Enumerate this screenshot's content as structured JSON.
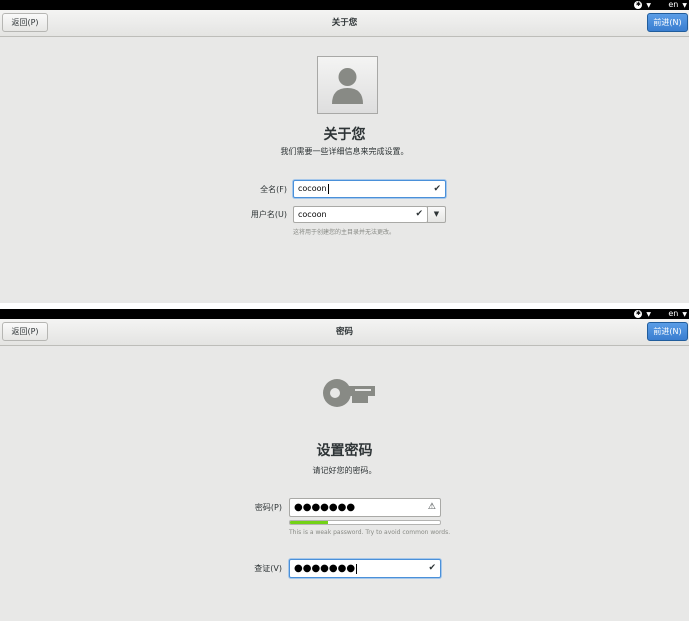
{
  "screen1": {
    "topbar": {
      "accessibility_icon": "accessibility-icon",
      "lang": "en"
    },
    "header": {
      "back_label": "返回(P)",
      "title": "关于您",
      "next_label": "前进(N)"
    },
    "avatar_icon": "user-avatar-icon",
    "heading": "关于您",
    "subtitle": "我们需要一些详细信息来完成设置。",
    "fullname": {
      "label": "全名(F)",
      "value": "cocoon",
      "status_icon": "check-icon"
    },
    "username": {
      "label": "用户名(U)",
      "value": "cocoon",
      "status_icon": "check-icon",
      "dropdown_icon": "chevron-down-icon"
    },
    "username_hint": "这将用于创建您的主目录并无法更改。"
  },
  "screen2": {
    "topbar": {
      "accessibility_icon": "accessibility-icon",
      "lang": "en"
    },
    "header": {
      "back_label": "返回(P)",
      "title": "密码",
      "next_label": "前进(N)"
    },
    "key_icon": "key-icon",
    "heading": "设置密码",
    "subtitle": "请记好您的密码。",
    "password": {
      "label": "密码(P)",
      "value": "●●●●●●●",
      "status_icon": "warning-icon",
      "strength": 0.25,
      "strength_color": "#73d216"
    },
    "password_hint": "This is a weak password. Try to avoid common words.",
    "confirm": {
      "label": "查证(V)",
      "value": "●●●●●●●",
      "status_icon": "check-icon"
    }
  }
}
